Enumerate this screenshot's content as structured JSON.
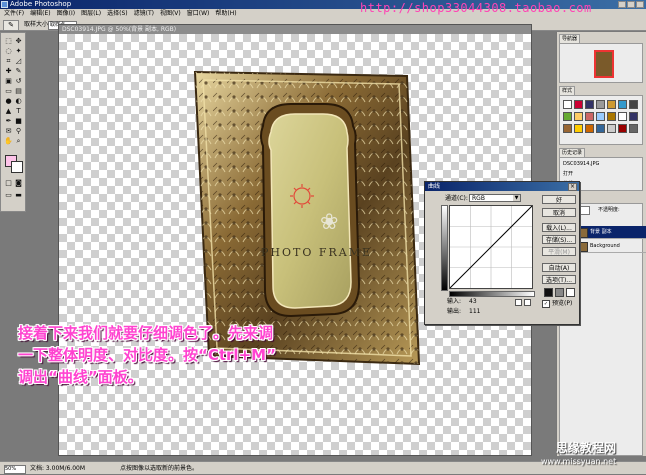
{
  "window": {
    "title": "Adobe Photoshop"
  },
  "menubar": [
    "文件(F)",
    "编辑(E)",
    "图像(I)",
    "图层(L)",
    "选择(S)",
    "滤镜(T)",
    "视图(V)",
    "窗口(W)",
    "帮助(H)"
  ],
  "optionsbar": {
    "label": "取样大小:",
    "value": "取样点"
  },
  "watermark_top": "http://shop33044308.taobao.com",
  "document": {
    "tab_title": "DSC03914.JPG @ 50%(背景 副本, RGB)",
    "artwork_text": "PHOTO FRAME"
  },
  "right_panel": {
    "navigator_tab": "导航器",
    "styles_tab": "样式",
    "history_tab": "历史记录",
    "history_items": [
      "DSC03914.JPG",
      "打开",
      "曲线"
    ],
    "layers_tab": "图层",
    "layers_blend": "正常",
    "layers_opacity": "不透明度:",
    "layers": [
      "背景 副本",
      "Background"
    ]
  },
  "curves_dialog": {
    "title": "曲线",
    "channel_label": "通道(C):",
    "channel_value": "RGB",
    "buttons": [
      "好",
      "取消",
      "载入(L)...",
      "存储(S)...",
      "平滑(M)",
      "自动(A)",
      "选项(T)..."
    ],
    "input_label": "输入:",
    "input_value": "43",
    "output_label": "输出:",
    "output_value": "111",
    "preview_label": "预览(P)",
    "preview_checked": true
  },
  "statusbar": {
    "zoom": "50%",
    "doc": "文档: 3.00M/6.00M",
    "hint": "点按图像以选取新的前景色。"
  },
  "caption": [
    "接着下来我们就要仔细调色了。先来调",
    "一下整体明度、对比度。按“Ctrl+M”",
    "调出“曲线”面板。"
  ],
  "site_logo": "思缘教程网",
  "site_url": "www.missyuan.net",
  "foreground_color": "#fdc3e8"
}
